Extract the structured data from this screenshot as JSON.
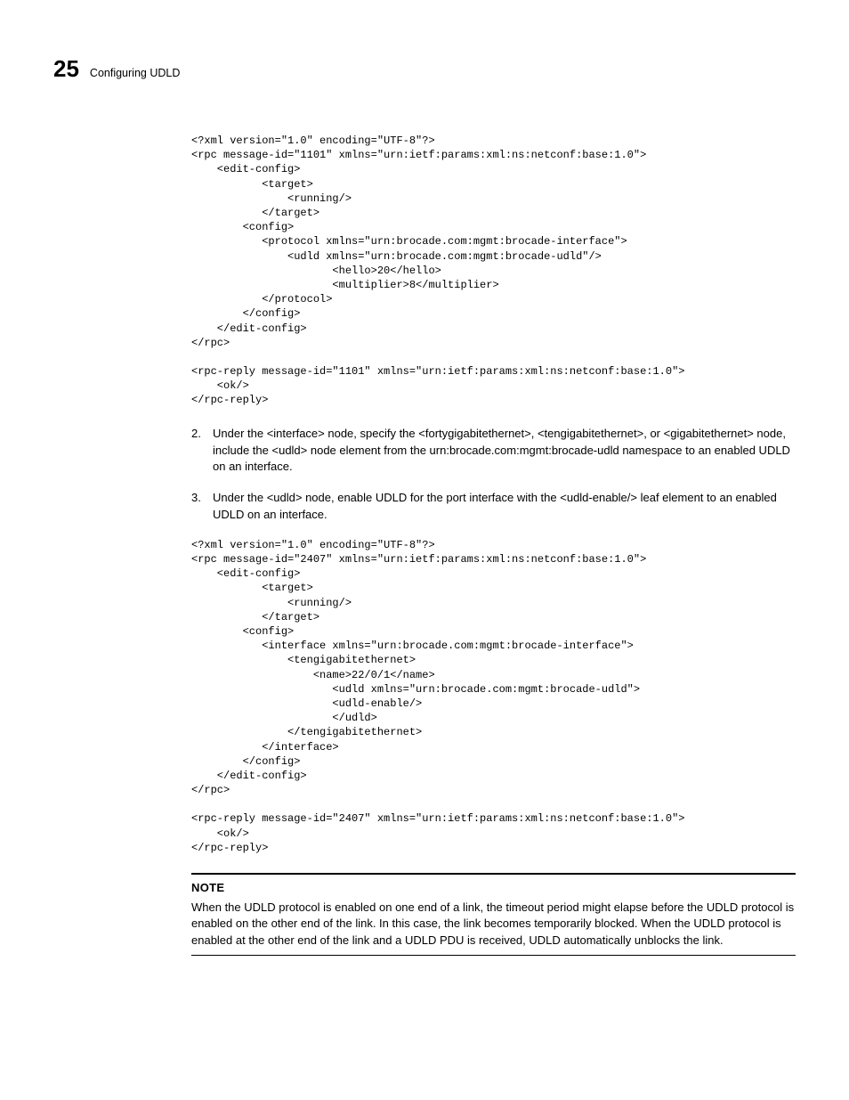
{
  "chapter": {
    "number": "25",
    "title": "Configuring UDLD"
  },
  "code1": "<?xml version=\"1.0\" encoding=\"UTF-8\"?>\n<rpc message-id=\"1101\" xmlns=\"urn:ietf:params:xml:ns:netconf:base:1.0\">\n    <edit-config>\n           <target>\n               <running/>\n           </target>\n        <config>\n           <protocol xmlns=\"urn:brocade.com:mgmt:brocade-interface\">\n               <udld xmlns=\"urn:brocade.com:mgmt:brocade-udld\"/>\n                      <hello>20</hello>\n                      <multiplier>8</multiplier>\n           </protocol>\n        </config>\n    </edit-config>\n</rpc>\n\n<rpc-reply message-id=\"1101\" xmlns=\"urn:ietf:params:xml:ns:netconf:base:1.0\">\n    <ok/>\n</rpc-reply>",
  "step2": "Under the <interface> node, specify the <fortygigabitethernet>, <tengigabitethernet>, or <gigabitethernet> node, include the <udld> node element from the urn:brocade.com:mgmt:brocade-udld namespace to an enabled UDLD on an interface.",
  "step3": "Under the <udld> node, enable UDLD for the port interface with the <udld-enable/> leaf element to an enabled UDLD on an interface.",
  "code2": "<?xml version=\"1.0\" encoding=\"UTF-8\"?>\n<rpc message-id=\"2407\" xmlns=\"urn:ietf:params:xml:ns:netconf:base:1.0\">\n    <edit-config>\n           <target>\n               <running/>\n           </target>\n        <config>\n           <interface xmlns=\"urn:brocade.com:mgmt:brocade-interface\">\n               <tengigabitethernet>\n                   <name>22/0/1</name>\n                      <udld xmlns=\"urn:brocade.com:mgmt:brocade-udld\">\n                      <udld-enable/>\n                      </udld>\n               </tengigabitethernet>\n           </interface>\n        </config>\n    </edit-config>\n</rpc>\n\n<rpc-reply message-id=\"2407\" xmlns=\"urn:ietf:params:xml:ns:netconf:base:1.0\">\n    <ok/>\n</rpc-reply>",
  "note": {
    "label": "NOTE",
    "body": "When the UDLD protocol is enabled on one end of a link, the timeout period might elapse before the UDLD protocol is enabled on the other end of the link. In this case, the link becomes temporarily blocked. When the UDLD protocol is enabled at the other end of the link and a UDLD PDU is received, UDLD automatically unblocks the link."
  }
}
